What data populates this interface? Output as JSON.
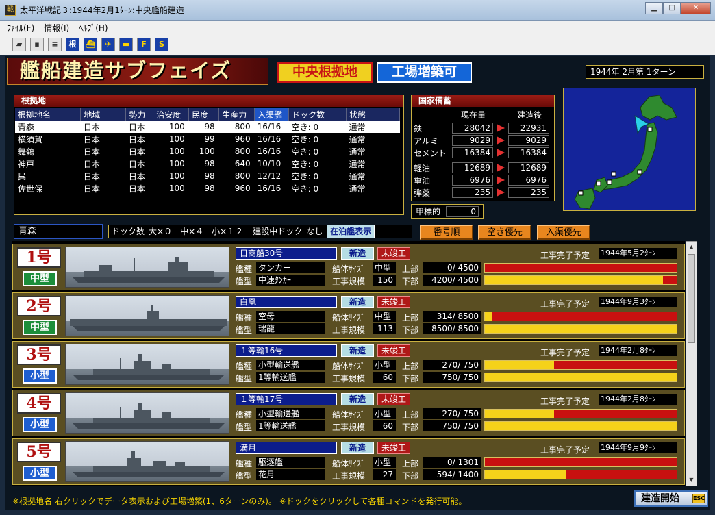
{
  "window": {
    "title": "太平洋戦記３:1944年2月1ﾀｰﾝ:中央艦船建造"
  },
  "menu": [
    "ﾌｧｲﾙ(F)",
    "情報(I)",
    "ﾍﾙﾌﾟ(H)"
  ],
  "toolbar": [
    "",
    "",
    "",
    "根",
    "",
    "",
    "",
    "F",
    "S"
  ],
  "phase": {
    "title": "艦船建造サブフェイズ",
    "tag1": "中央根拠地",
    "tag2": "工場増築可",
    "turn": "1944年 2月第 1ターン"
  },
  "bases": {
    "panel_title": "根拠地",
    "columns": [
      "根拠地名",
      "地域",
      "勢力",
      "治安度",
      "民度",
      "生産力",
      "入渠艦",
      "ドック数",
      "状態"
    ],
    "rows": [
      [
        "青森",
        "日本",
        "日本",
        "100",
        "98",
        "800",
        "16/16",
        "空き: 0",
        "通常"
      ],
      [
        "横須賀",
        "日本",
        "日本",
        "100",
        "99",
        "960",
        "16/16",
        "空き: 0",
        "通常"
      ],
      [
        "舞鶴",
        "日本",
        "日本",
        "100",
        "100",
        "800",
        "16/16",
        "空き: 0",
        "通常"
      ],
      [
        "神戸",
        "日本",
        "日本",
        "100",
        "98",
        "640",
        "10/10",
        "空き: 0",
        "通常"
      ],
      [
        "呉",
        "日本",
        "日本",
        "100",
        "98",
        "800",
        "12/12",
        "空き: 0",
        "通常"
      ],
      [
        "佐世保",
        "日本",
        "日本",
        "100",
        "98",
        "960",
        "16/16",
        "空き: 0",
        "通常"
      ]
    ]
  },
  "stockpile": {
    "panel_title": "国家備蓄",
    "col_current": "現在量",
    "col_after": "建造後",
    "group1": [
      {
        "name": "鉄",
        "current": "28042",
        "after": "22931"
      },
      {
        "name": "アルミ",
        "current": "9029",
        "after": "9029"
      },
      {
        "name": "セメント",
        "current": "16384",
        "after": "16384"
      }
    ],
    "group2": [
      {
        "name": "軽油",
        "current": "12689",
        "after": "12689"
      },
      {
        "name": "重油",
        "current": "6976",
        "after": "6976"
      },
      {
        "name": "弾薬",
        "current": "235",
        "after": "235"
      }
    ]
  },
  "target": {
    "label": "甲標的",
    "value": "0"
  },
  "selected_base": "青森",
  "dockinfo": {
    "label": "ドック数",
    "counts": "大×０　中×４　小×１２",
    "building_label": "建設中ドック",
    "building_value": "なし",
    "button": "在泊艦表示"
  },
  "sort_buttons": [
    "番号順",
    "空き優先",
    "入渠優先"
  ],
  "field_labels": {
    "type": "艦種",
    "class": "艦型",
    "hull_size": "船体ｻｲｽﾞ",
    "scale": "工事規模",
    "upper": "上部",
    "lower": "下部",
    "completion": "工事完了予定"
  },
  "docks": [
    {
      "num": "1号",
      "size": "中型",
      "size_class": "med",
      "ship_name": "日商船30号",
      "new_label": "新造",
      "status": "未竣工",
      "type": "タンカー",
      "class": "中速ﾀﾝｶｰ",
      "hull": "中型",
      "scale": "150",
      "upper": "0/ 4500",
      "lower": "4200/ 4500",
      "upper_pct": 0,
      "lower_pct": 93,
      "completion": "1944年5月2ﾀｰﾝ",
      "ship_kind": "tanker"
    },
    {
      "num": "2号",
      "size": "中型",
      "size_class": "med",
      "ship_name": "白凰",
      "new_label": "新造",
      "status": "未竣工",
      "type": "空母",
      "class": "瑞龍",
      "hull": "中型",
      "scale": "113",
      "upper": "314/ 8500",
      "lower": "8500/ 8500",
      "upper_pct": 4,
      "lower_pct": 100,
      "completion": "1944年9月3ﾀｰﾝ",
      "ship_kind": "carrier"
    },
    {
      "num": "3号",
      "size": "小型",
      "size_class": "small",
      "ship_name": "１等輸16号",
      "new_label": "新造",
      "status": "未竣工",
      "type": "小型輸送艦",
      "class": "1等輸送艦",
      "hull": "小型",
      "scale": "60",
      "upper": "270/ 750",
      "lower": "750/ 750",
      "upper_pct": 36,
      "lower_pct": 100,
      "completion": "1944年2月8ﾀｰﾝ",
      "ship_kind": "transport"
    },
    {
      "num": "4号",
      "size": "小型",
      "size_class": "small",
      "ship_name": "１等輸17号",
      "new_label": "新造",
      "status": "未竣工",
      "type": "小型輸送艦",
      "class": "1等輸送艦",
      "hull": "小型",
      "scale": "60",
      "upper": "270/ 750",
      "lower": "750/ 750",
      "upper_pct": 36,
      "lower_pct": 100,
      "completion": "1944年2月8ﾀｰﾝ",
      "ship_kind": "transport"
    },
    {
      "num": "5号",
      "size": "小型",
      "size_class": "small",
      "ship_name": "満月",
      "new_label": "新造",
      "status": "未竣工",
      "type": "駆逐艦",
      "class": "花月",
      "hull": "小型",
      "scale": "27",
      "upper": "0/ 1301",
      "lower": "594/ 1400",
      "upper_pct": 0,
      "lower_pct": 42,
      "completion": "1944年9月9ﾀｰﾝ",
      "ship_kind": "destroyer"
    }
  ],
  "footnote": "※根拠地名 右クリックでデータ表示および工場増築(1、6ターンのみ)。 ※ドックをクリックして各種コマンドを発行可能。",
  "start_button": "建造開始",
  "esc_label": "ESC"
}
